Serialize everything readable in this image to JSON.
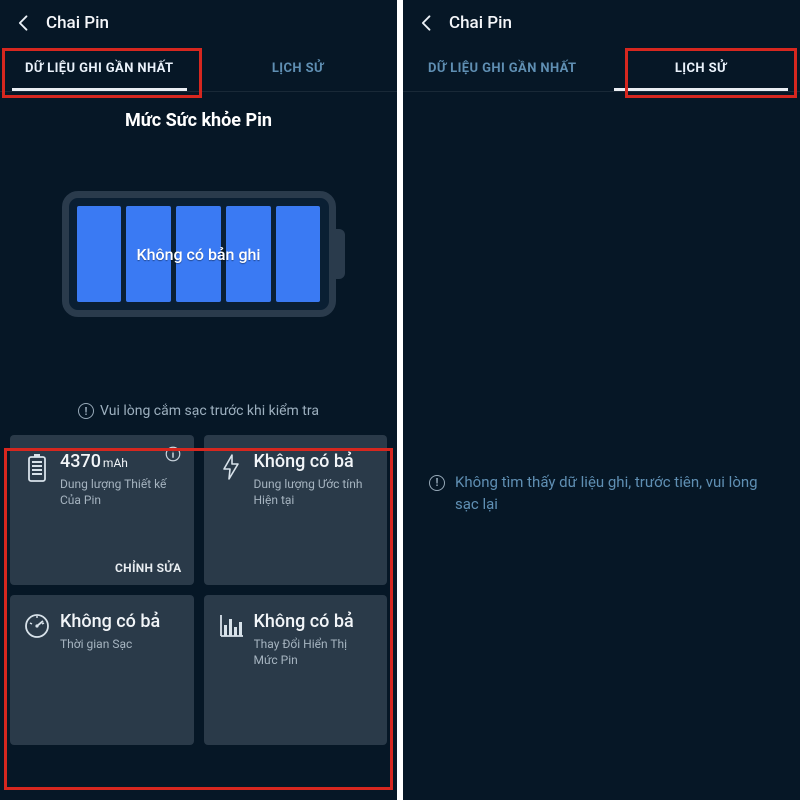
{
  "left": {
    "header_title": "Chai Pin",
    "tabs": {
      "latest": "DỮ LIỆU GHI GẦN NHẤT",
      "history": "LỊCH SỬ"
    },
    "section_title": "Mức Sức khỏe Pin",
    "battery_text": "Không có bản ghi",
    "hint": "Vui lòng cắm sạc trước khi kiểm tra",
    "cards": {
      "capacity": {
        "value": "4370",
        "unit": "mAh",
        "sub": "Dung lượng Thiết kế Của Pin",
        "action": "CHỈNH SỬA"
      },
      "estimated": {
        "value": "Không có bả",
        "sub": "Dung lượng Ước tính Hiện tại"
      },
      "chargetime": {
        "value": "Không có bả",
        "sub": "Thời gian Sạc"
      },
      "display": {
        "value": "Không có bả",
        "sub": "Thay Đổi Hiển Thị Mức Pin"
      }
    }
  },
  "right": {
    "header_title": "Chai Pin",
    "tabs": {
      "latest": "DỮ LIỆU GHI GẦN NHẤT",
      "history": "LỊCH SỬ"
    },
    "empty": "Không tìm thấy dữ liệu ghi, trước tiên, vui lòng sạc lại"
  }
}
